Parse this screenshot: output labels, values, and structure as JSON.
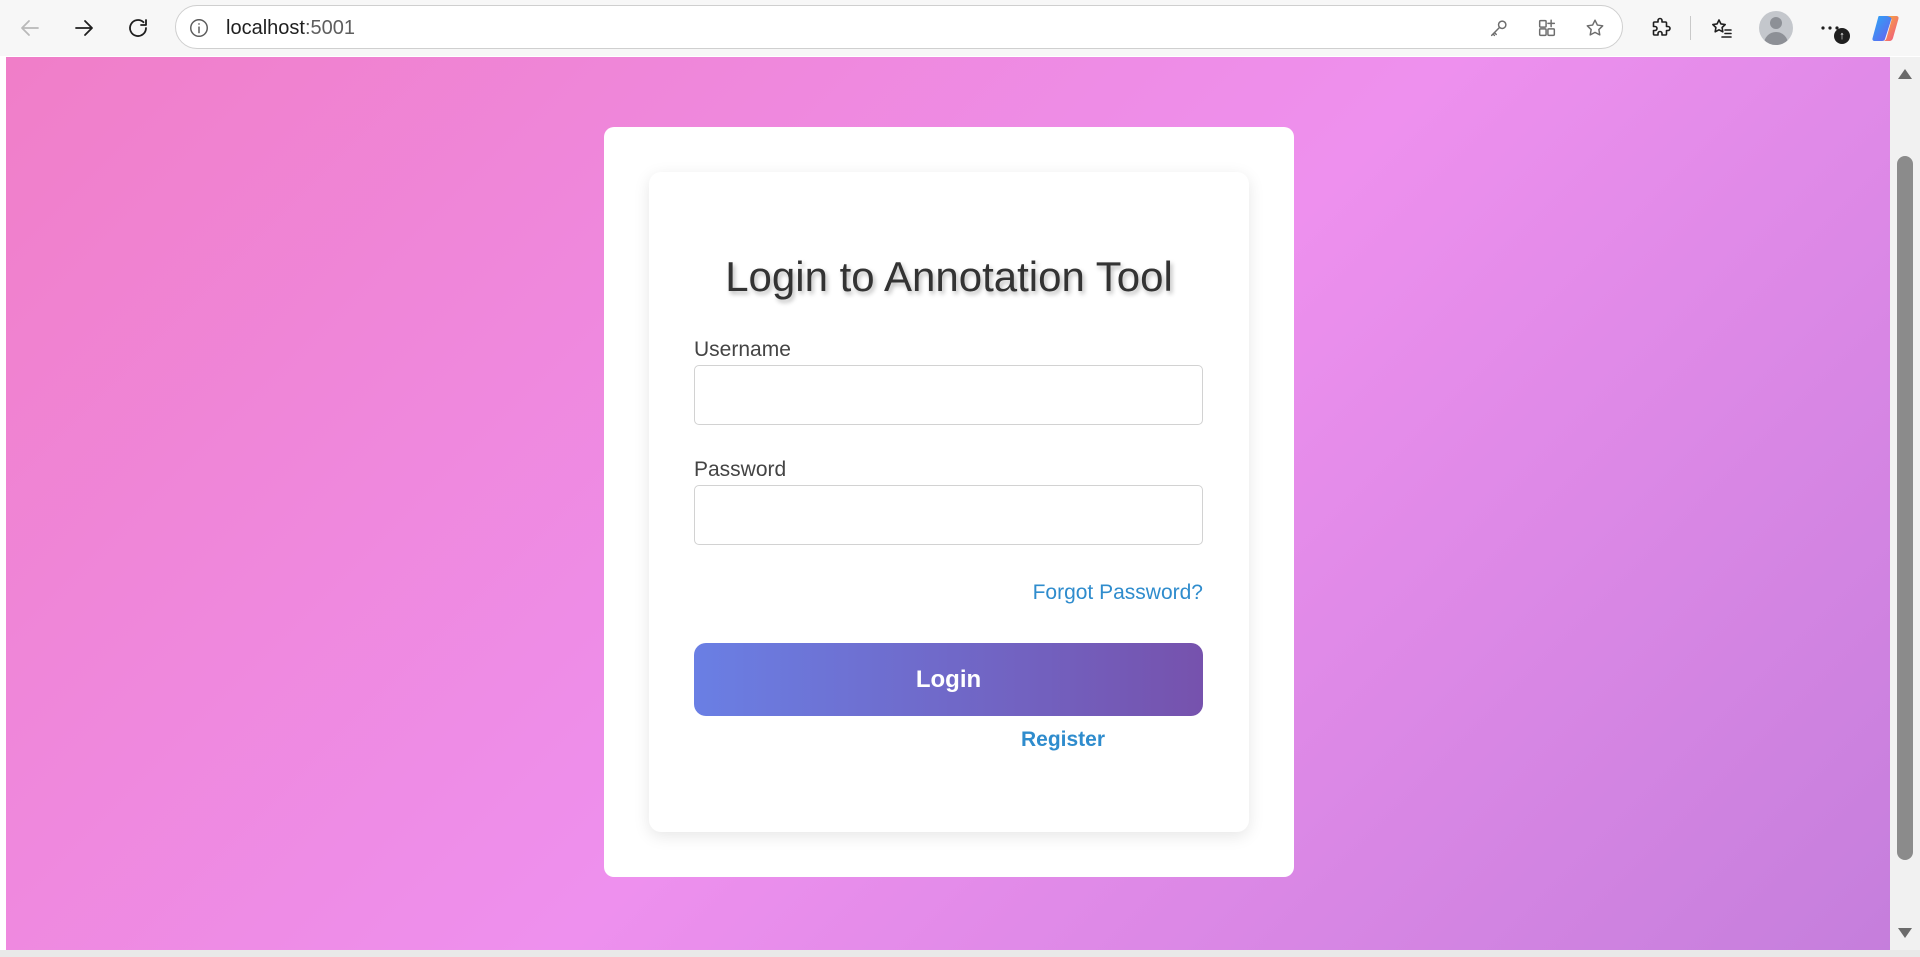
{
  "browser": {
    "url_host": "localhost",
    "url_port": ":5001"
  },
  "icons": {
    "back": "arrow-left",
    "forward": "arrow-right",
    "refresh": "refresh",
    "site_info": "info-circle",
    "password_key": "key",
    "app_available": "apps-plus",
    "favorite": "star",
    "extensions": "puzzle",
    "favorites": "star-list",
    "profile": "person-avatar",
    "more": "ellipsis",
    "copilot": "copilot"
  },
  "colors": {
    "background_gradient_start": "#f07ec8",
    "background_gradient_mid": "#ee90ee",
    "background_gradient_end": "#c57edc",
    "button_gradient_start": "#6a7fe4",
    "button_gradient_end": "#7652ad",
    "link": "#2f8ccd"
  },
  "login": {
    "title": "Login to Annotation Tool",
    "username_label": "Username",
    "username_value": "",
    "password_label": "Password",
    "password_value": "",
    "forgot_password": "Forgot Password?",
    "login_button": "Login",
    "register_link": "Register"
  }
}
